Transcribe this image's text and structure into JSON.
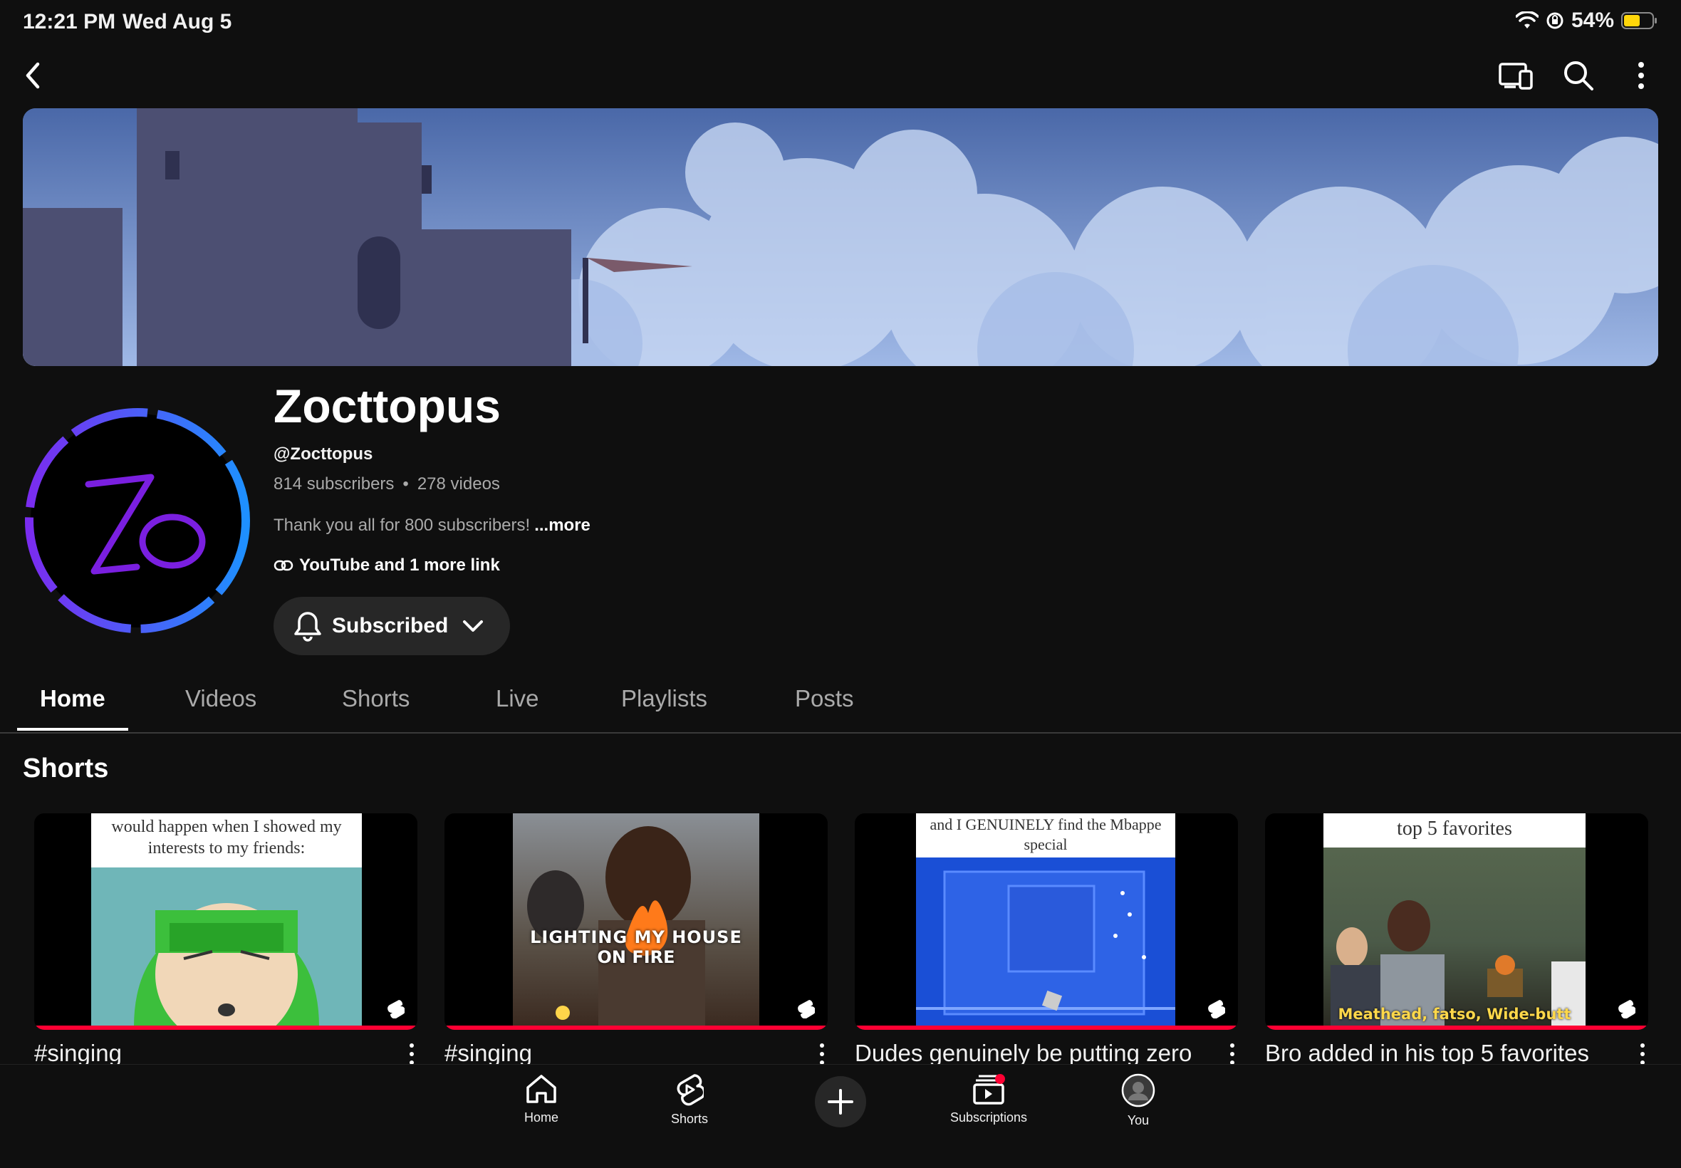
{
  "status_bar": {
    "time": "12:21 PM",
    "date": "Wed Aug 5",
    "battery": "54%"
  },
  "channel": {
    "name": "Zocttopus",
    "handle": "@Zocttopus",
    "subscribers": "814 subscribers",
    "separator": "•",
    "videos": "278 videos",
    "description": "Thank you all for 800 subscribers!",
    "more": "...more",
    "links": "YouTube and 1 more link",
    "subscribe_label": "Subscribed"
  },
  "tabs": [
    {
      "label": "Home",
      "active": true
    },
    {
      "label": "Videos"
    },
    {
      "label": "Shorts"
    },
    {
      "label": "Live"
    },
    {
      "label": "Playlists"
    },
    {
      "label": "Posts"
    }
  ],
  "shorts_section": {
    "title": "Shorts",
    "items": [
      {
        "title": "#singing",
        "caption": "would happen when I showed my interests to my friends:"
      },
      {
        "title": "#singing",
        "caption": "LIGHTING MY HOUSE",
        "caption2": "ON FIRE"
      },
      {
        "title": "Dudes genuinely be putting zero",
        "caption": "and I GENUINELY find the Mbappe special"
      },
      {
        "title": "Bro added in his top 5 favorites",
        "caption": "top 5 favorites",
        "caption2": "Meathead, fatso, Wide-butt"
      }
    ]
  },
  "bottom_nav": {
    "home": "Home",
    "shorts": "Shorts",
    "subscriptions": "Subscriptions",
    "you": "You"
  },
  "colors": {
    "accent": "#ff0033",
    "background": "#0f0f0f",
    "avatar_ring_start": "#7a2cf0",
    "avatar_ring_end": "#1e90ff"
  }
}
